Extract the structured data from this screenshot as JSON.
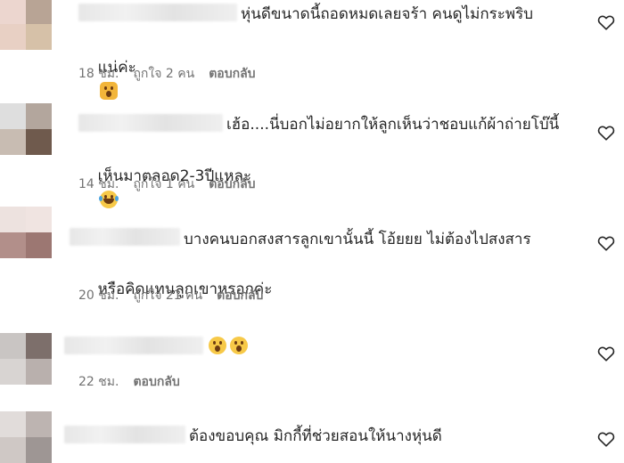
{
  "comments": [
    {
      "text_first": "หุ่นดีขนาดนี้ถอดหมดเลยจร้า คนดูไม่กระพริบ",
      "text_second": "แน่ค่ะ",
      "emoji": "astonished-cat-icon",
      "time": "18 ชม.",
      "likes": "ถูกใจ 2 คน",
      "reply": "ตอบกลับ"
    },
    {
      "text_first": "เฮ้อ....นี่บอกไม่อยากให้ลูกเห็นว่าชอบแก้ผ้าถ่ายโบ๊นี้",
      "text_second": "เห็นมาตลอด2-3ปีแหละ",
      "emoji": "tears-of-joy-icon",
      "time": "14 ชม.",
      "likes": "ถูกใจ 1 คน",
      "reply": "ตอบกลับ"
    },
    {
      "text_first": "บางคนบอกสงสารลูกเขานั้นนี้ โอ้ยยย ไม่ต้องไปสงสาร",
      "text_second": "หรือคิดแทนลูกเขาหรอกค่ะ",
      "time": "20 ชม.",
      "likes": "ถูกใจ 21 คน",
      "reply": "ตอบกลับ"
    },
    {
      "emoji": "astonished-face-icon",
      "time": "22 ชม.",
      "reply": "ตอบกลับ"
    },
    {
      "text_first": "ต้องขอบคุณ มิกกี้ที่ช่วยสอนให้นางหุ่นดี"
    }
  ],
  "icons": {
    "like": "heart-outline-icon"
  },
  "colors": {
    "text": "#262626",
    "meta": "#737373",
    "blur": "#e7e7e7"
  }
}
